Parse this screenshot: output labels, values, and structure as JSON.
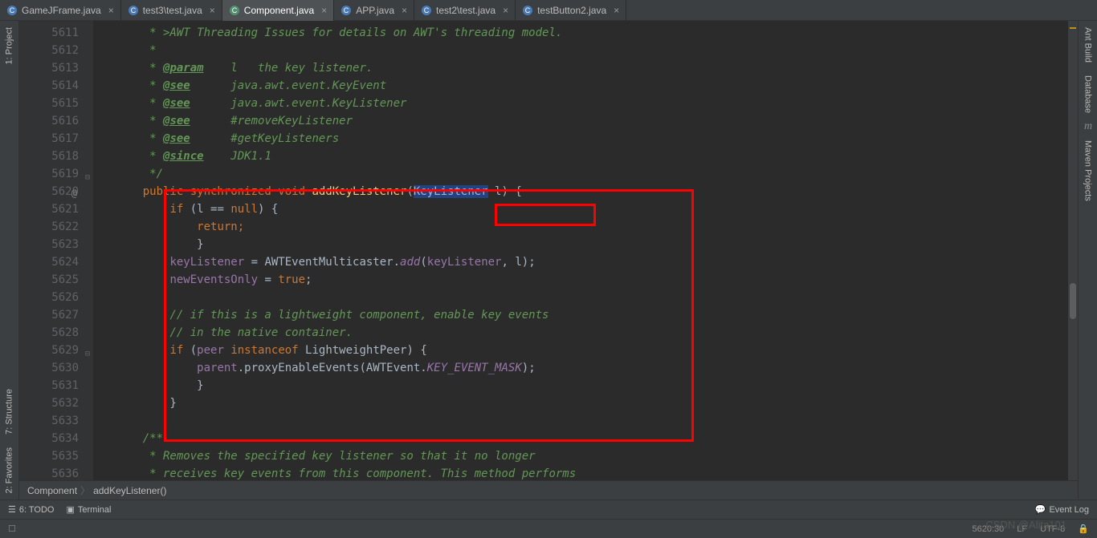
{
  "tabs": [
    {
      "label": "GameJFrame.java",
      "active": false,
      "icon": "class"
    },
    {
      "label": "test3\\test.java",
      "active": false,
      "icon": "class"
    },
    {
      "label": "Component.java",
      "active": true,
      "icon": "class-lib"
    },
    {
      "label": "APP.java",
      "active": false,
      "icon": "class"
    },
    {
      "label": "test2\\test.java",
      "active": false,
      "icon": "class"
    },
    {
      "label": "testButton2.java",
      "active": false,
      "icon": "class"
    }
  ],
  "left_rail": [
    {
      "label": "1: Project",
      "name": "project-tool"
    },
    {
      "label": "7: Structure",
      "name": "structure-tool"
    },
    {
      "label": "2: Favorites",
      "name": "favorites-tool"
    }
  ],
  "right_rail": [
    {
      "label": "Ant Build",
      "name": "ant-build-tool"
    },
    {
      "label": "Database",
      "name": "database-tool"
    },
    {
      "label": "Maven Projects",
      "name": "maven-tool"
    }
  ],
  "gutter_start": 5611,
  "gutter_rows": 26,
  "code_lines": [
    {
      "type": "comment",
      "text": "     * >AWT Threading Issues</a> for details on AWT's threading model."
    },
    {
      "type": "comment",
      "text": "     *"
    },
    {
      "type": "comment-tag",
      "text": "     * @param    l   the key listener."
    },
    {
      "type": "comment-see",
      "text": "     * @see      java.awt.event.KeyEvent"
    },
    {
      "type": "comment-see",
      "text": "     * @see      java.awt.event.KeyListener"
    },
    {
      "type": "comment-see",
      "text": "     * @see      #removeKeyListener"
    },
    {
      "type": "comment-see",
      "text": "     * @see      #getKeyListeners"
    },
    {
      "type": "comment-since",
      "text": "     * @since    JDK1.1"
    },
    {
      "type": "comment",
      "text": "     */"
    },
    {
      "type": "method-sig"
    },
    {
      "type": "if-null"
    },
    {
      "type": "return"
    },
    {
      "type": "brace-close",
      "indent": 8
    },
    {
      "type": "assign-kl"
    },
    {
      "type": "assign-neo"
    },
    {
      "type": "blank"
    },
    {
      "type": "comment-inline",
      "text": "        // if this is a lightweight component, enable key events"
    },
    {
      "type": "comment-inline",
      "text": "        // in the native container."
    },
    {
      "type": "if-peer"
    },
    {
      "type": "proxy"
    },
    {
      "type": "brace-close",
      "indent": 8
    },
    {
      "type": "brace-close",
      "indent": 4
    },
    {
      "type": "blank"
    },
    {
      "type": "comment",
      "text": "    /**"
    },
    {
      "type": "comment",
      "text": "     * Removes the specified key listener so that it no longer"
    },
    {
      "type": "comment",
      "text": "     * receives key events from this component. This method performs"
    }
  ],
  "breadcrumbs": [
    "Component",
    "addKeyListener()"
  ],
  "bottom_tools": {
    "todo": "6: TODO",
    "terminal": "Terminal",
    "event_log": "Event Log"
  },
  "status": {
    "pos": "5620:30",
    "le": "LF",
    "encoding": "UTF-8",
    "lock": "🔒"
  },
  "watermark": "CSDN @Alita101"
}
